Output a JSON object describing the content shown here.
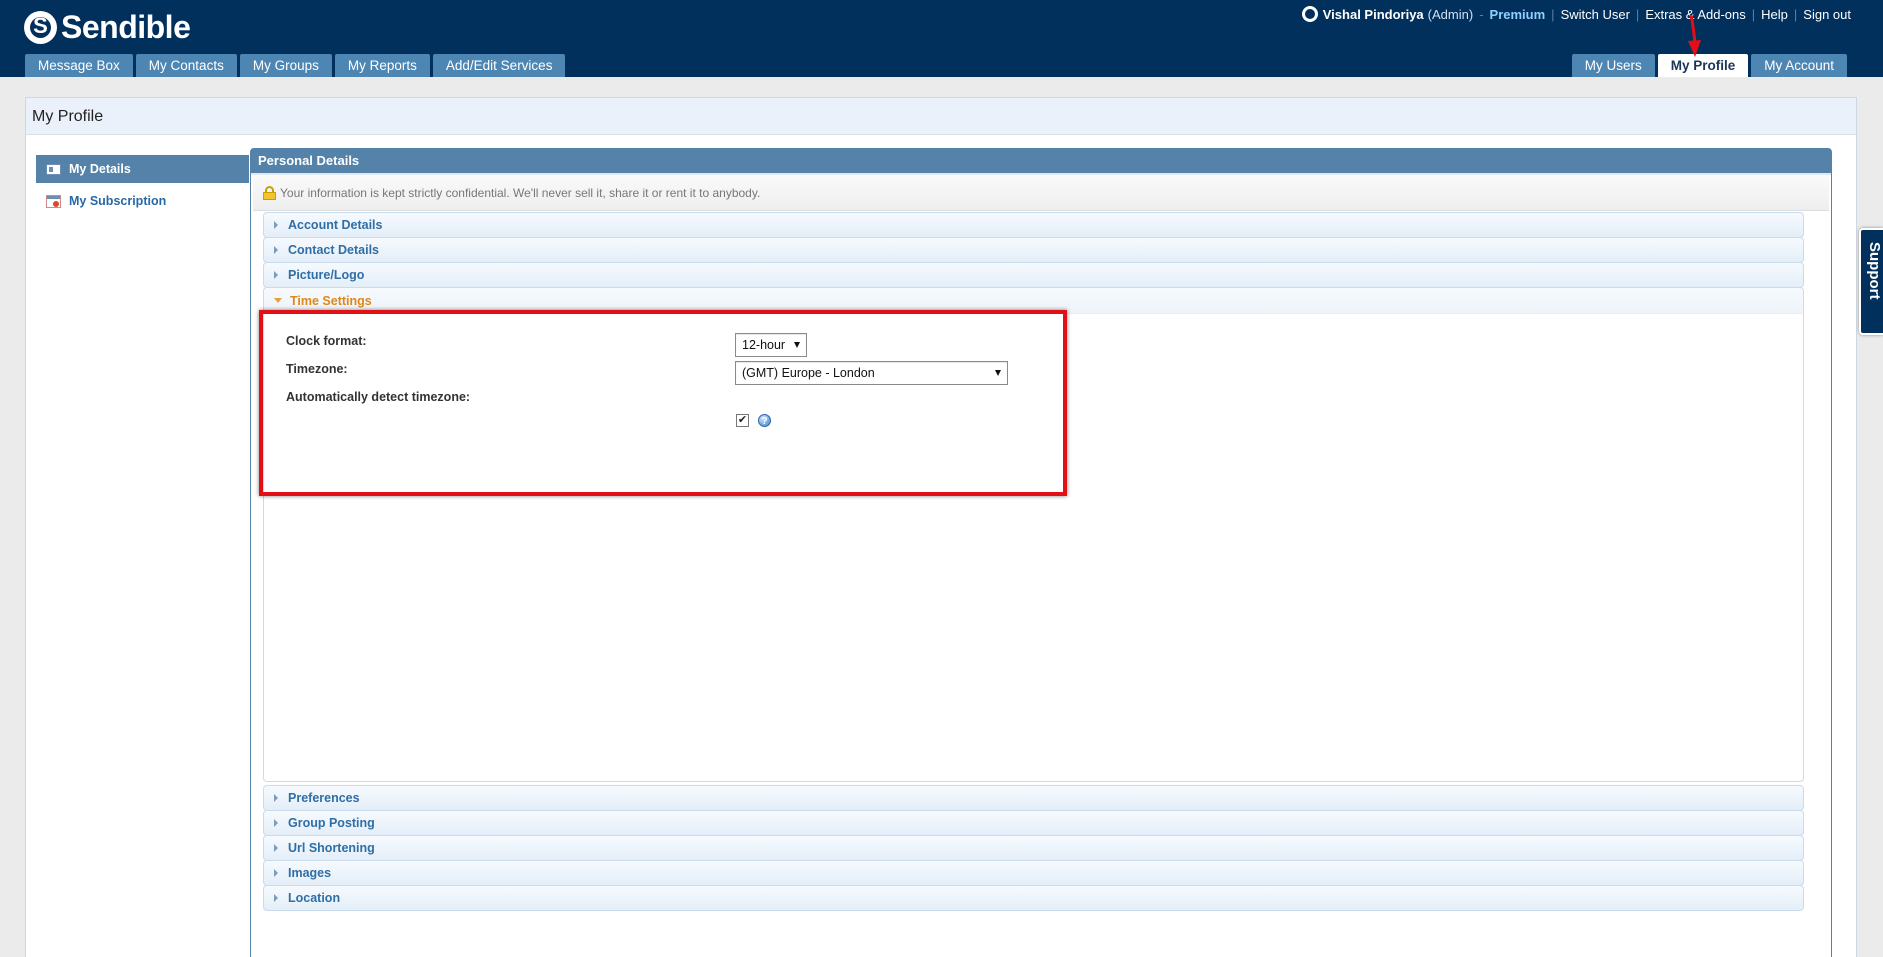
{
  "brand": {
    "name": "Sendible"
  },
  "userbar": {
    "user_name": "Vishal Pindoriya",
    "user_role": "(Admin)",
    "separator": "-",
    "plan": "Premium",
    "links": [
      "Switch User",
      "Extras & Add-ons",
      "Help",
      "Sign out"
    ]
  },
  "nav": {
    "left_tabs": [
      "Message Box",
      "My Contacts",
      "My Groups",
      "My Reports",
      "Add/Edit Services"
    ],
    "right_tabs": [
      "My Users",
      "My Profile",
      "My Account"
    ],
    "active_tab": "My Profile"
  },
  "page": {
    "title": "My Profile"
  },
  "sidebar": {
    "items": [
      {
        "label": "My Details",
        "icon": "id-card-icon",
        "active": true
      },
      {
        "label": "My Subscription",
        "icon": "subscription-icon",
        "active": false
      }
    ]
  },
  "panel": {
    "title": "Personal Details",
    "notice": "Your information is kept strictly confidential. We'll never sell it, share it or rent it to anybody.",
    "sections_before": [
      "Account Details",
      "Contact Details",
      "Picture/Logo"
    ],
    "open_section": {
      "title": "Time Settings",
      "fields": {
        "clock_format": {
          "label": "Clock format:",
          "value": "12-hour"
        },
        "timezone": {
          "label": "Timezone:",
          "value": "(GMT) Europe - London"
        },
        "auto_detect": {
          "label": "Automatically detect timezone:",
          "checked": true,
          "check_glyph": "✔",
          "help_glyph": "?"
        }
      }
    },
    "sections_after": [
      "Preferences",
      "Group Posting",
      "Url Shortening",
      "Images",
      "Location"
    ]
  },
  "support": {
    "label": "Support"
  },
  "colors": {
    "header": "#02305d",
    "tab": "#4e86b3",
    "panel": "#5482a9",
    "highlight": "#e01016",
    "open_section": "#e0871a"
  }
}
